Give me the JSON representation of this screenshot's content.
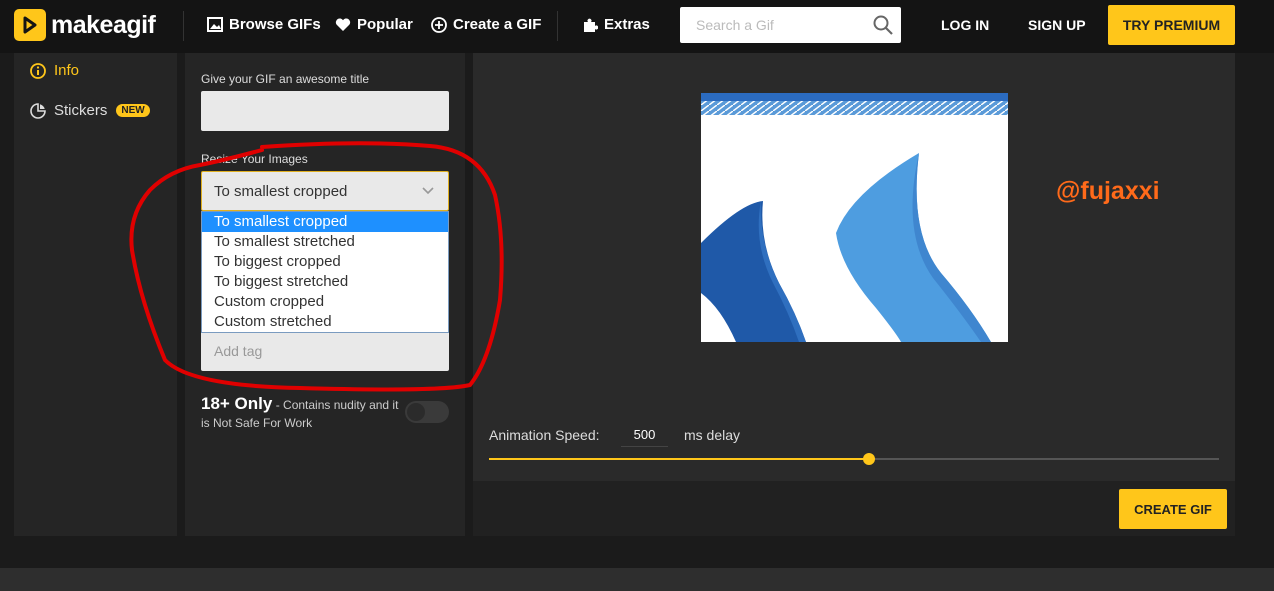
{
  "brand": {
    "name": "makeagif",
    "accent": "#ffc61a"
  },
  "nav": {
    "browse": "Browse GIFs",
    "popular": "Popular",
    "create": "Create a GIF",
    "extras": "Extras"
  },
  "search": {
    "placeholder": "Search a Gif"
  },
  "auth": {
    "login": "LOG IN",
    "signup": "SIGN UP",
    "premium": "TRY PREMIUM"
  },
  "sidebar": {
    "items": [
      {
        "label": "Info",
        "icon": "info-icon",
        "active": true
      },
      {
        "label": "Stickers",
        "icon": "sticker-icon",
        "badge": "NEW"
      }
    ]
  },
  "form": {
    "title_label": "Give your GIF an awesome title",
    "title_value": "",
    "resize_label": "Resize Your Images",
    "resize_selected": "To smallest cropped",
    "resize_options": [
      "To smallest cropped",
      "To smallest stretched",
      "To biggest cropped",
      "To biggest stretched",
      "Custom cropped",
      "Custom stretched"
    ],
    "tag_placeholder": "Add tag",
    "nsfw_title": "18+ Only",
    "nsfw_desc": " - Contains nudity and it is Not Safe For Work",
    "nsfw_enabled": false
  },
  "preview": {
    "watermark": "@fujaxxi",
    "speed_label": "Animation Speed:",
    "speed_value": "500",
    "speed_unit": "ms delay",
    "slider_fraction": 0.52
  },
  "actions": {
    "create": "CREATE GIF"
  }
}
